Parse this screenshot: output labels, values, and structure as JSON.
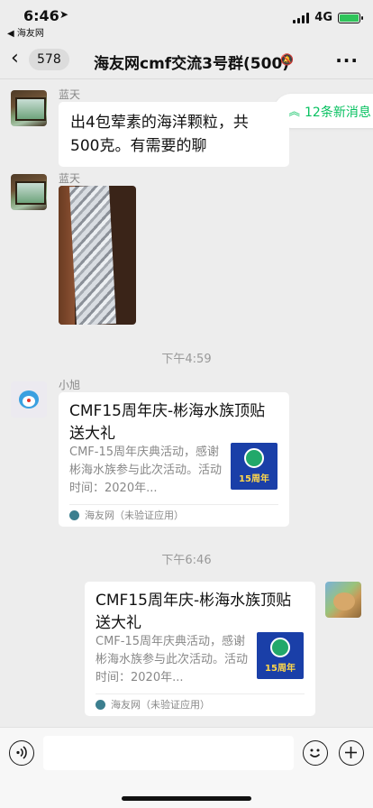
{
  "status": {
    "time": "6:46",
    "back_app": "◀ 海友网",
    "network": "4G",
    "battery_level": 0.9,
    "battery_color": "#2fc45a"
  },
  "nav": {
    "unread_count": "578",
    "title": "海友网cmf交流3号群(500)",
    "more": "···"
  },
  "new_messages": {
    "label": "12条新消息",
    "accent": "#07c160"
  },
  "messages": [
    {
      "type": "text",
      "sender": "蓝天",
      "text": "出4包荤素的海洋颗粒，共500克。有需要的聊"
    },
    {
      "type": "image",
      "sender": "蓝天",
      "content": "silver bag photo"
    },
    {
      "type": "time",
      "text": "下午4:59"
    },
    {
      "type": "link",
      "sender": "小旭",
      "title": "CMF15周年庆-彬海水族顶贴送大礼",
      "desc": "CMF-15周年庆典活动，感谢彬海水族参与此次活动。活动时间：2020年...",
      "thumb_text": "15周年",
      "source": "海友网（未验证应用）"
    },
    {
      "type": "time",
      "text": "下午6:46"
    },
    {
      "type": "link",
      "sender": "me",
      "title": "CMF15周年庆-彬海水族顶贴送大礼",
      "desc": "CMF-15周年庆典活动，感谢彬海水族参与此次活动。活动时间：2020年...",
      "thumb_text": "15周年",
      "source": "海友网（未验证应用）"
    }
  ],
  "input": {
    "value": "",
    "icons": [
      "voice-icon",
      "emoji-icon",
      "plus-icon"
    ]
  }
}
